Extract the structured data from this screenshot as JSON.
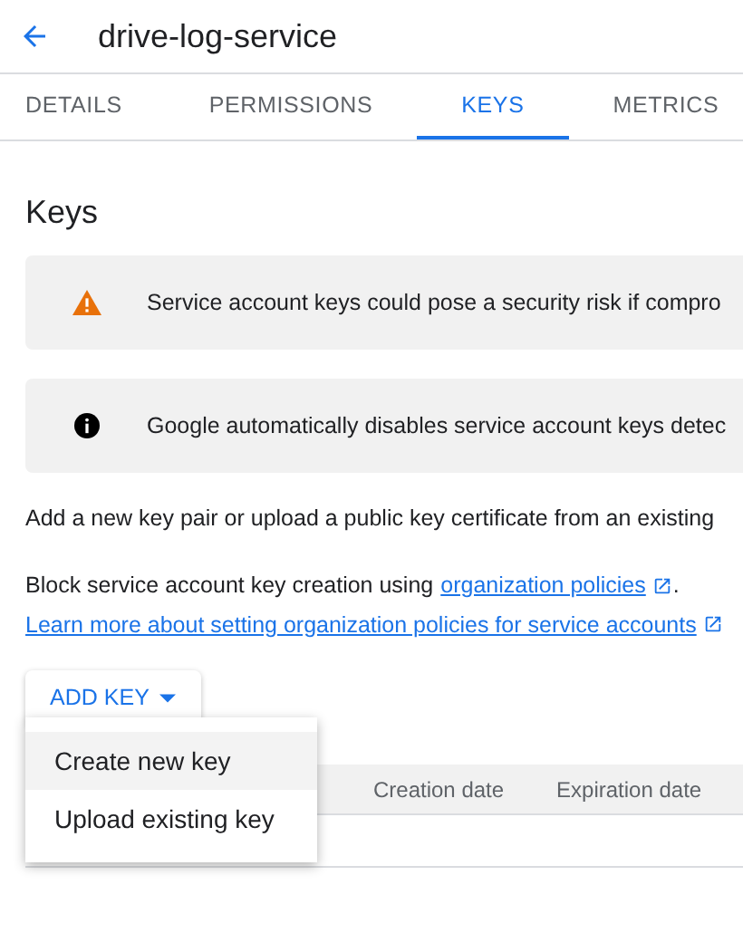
{
  "header": {
    "title": "drive-log-service"
  },
  "tabs": [
    {
      "label": "DETAILS",
      "selected": false
    },
    {
      "label": "PERMISSIONS",
      "selected": false
    },
    {
      "label": "KEYS",
      "selected": true
    },
    {
      "label": "METRICS",
      "selected": false
    }
  ],
  "section_title": "Keys",
  "notices": [
    {
      "kind": "warning",
      "text": "Service account keys could pose a security risk if compro"
    },
    {
      "kind": "info",
      "text": "Google automatically disables service account keys detec"
    }
  ],
  "description": "Add a new key pair or upload a public key certificate from an existing",
  "policy_text": "Block service account key creation using",
  "policy_link": "organization policies",
  "policy_end": ".",
  "learn_more_link": "Learn more about setting organization policies for service accounts",
  "add_key_button": "ADD KEY",
  "menu": [
    {
      "label": "Create new key",
      "highlighted": true
    },
    {
      "label": "Upload existing key",
      "highlighted": false
    }
  ],
  "table": {
    "columns": [
      "Creation date",
      "Expiration date"
    ]
  }
}
